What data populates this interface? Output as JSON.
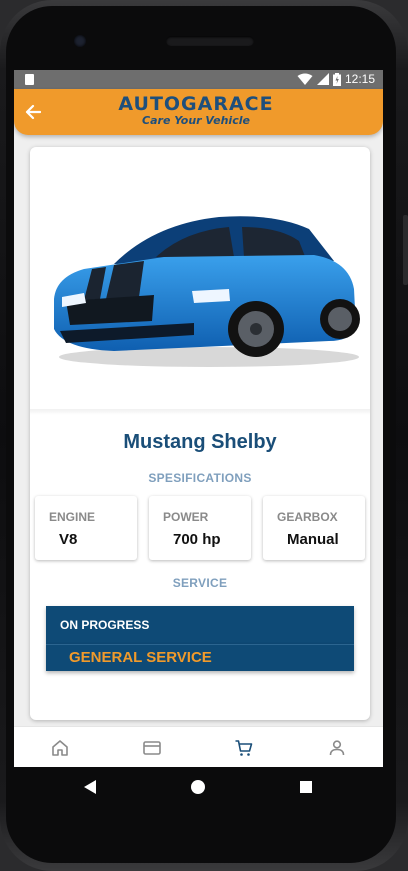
{
  "status_bar": {
    "time": "12:15",
    "icons": [
      "sim-card-icon",
      "wifi-icon",
      "signal-icon",
      "battery-icon"
    ]
  },
  "app_bar": {
    "back_icon": "arrow-left-icon",
    "logo_title": "AUTOGARACE",
    "logo_tagline": "Care Your Vehicle",
    "background_color": "#f09a2b",
    "logo_color": "#1e4f7c"
  },
  "car": {
    "name": "Mustang Shelby",
    "image": "blue-mustang-shelby-photo"
  },
  "specs": {
    "section_title": "SPESIFICATIONS",
    "items": [
      {
        "label": "ENGINE",
        "value": "V8"
      },
      {
        "label": "POWER",
        "value": "700 hp"
      },
      {
        "label": "GEARBOX",
        "value": "Manual"
      }
    ]
  },
  "service": {
    "section_title": "SERVICE",
    "status": "ON PROGRESS",
    "type": "GENERAL SERVICE",
    "background_color": "#0e4a76",
    "accent_color": "#f09a2b"
  },
  "bottom_nav": {
    "items": [
      {
        "icon": "home-icon",
        "active": false
      },
      {
        "icon": "credit-card-icon",
        "active": false
      },
      {
        "icon": "cart-icon",
        "active": true
      },
      {
        "icon": "profile-icon",
        "active": false
      }
    ],
    "active_color": "#1a4e78"
  },
  "system_nav": {
    "icons": [
      "back-triangle-icon",
      "home-circle-icon",
      "recents-square-icon"
    ]
  }
}
